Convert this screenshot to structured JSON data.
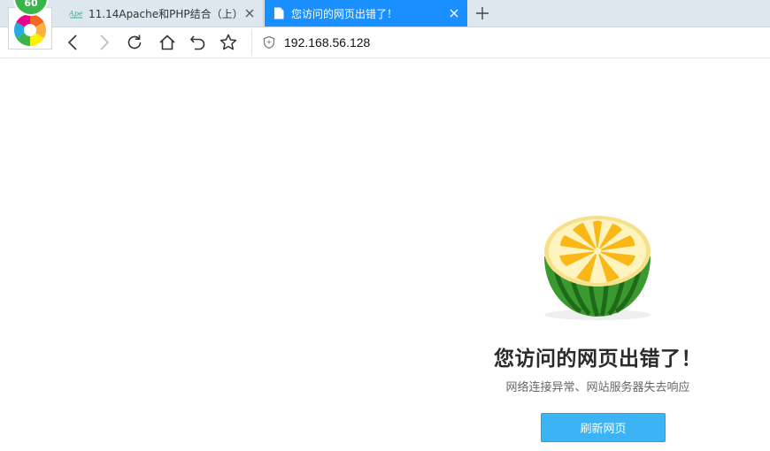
{
  "browser": {
    "badge_count": "60",
    "tabs": [
      {
        "label": "11.14Apache和PHP结合（上）",
        "favicon": "apeg-favicon-icon",
        "active": false
      },
      {
        "label": "您访问的网页出错了！",
        "favicon": "page-icon",
        "active": true
      }
    ],
    "address": {
      "url": "192.168.56.128"
    }
  },
  "error_page": {
    "title": "您访问的网页出错了！",
    "subtitle": "网络连接异常、网站服务器失去响应",
    "refresh_label": "刷新网页",
    "illustration": "lemon-watermelon-illustration"
  },
  "colors": {
    "active_tab": "#1a8fff",
    "refresh_button": "#3cb3f5",
    "badge": "#39b54a"
  }
}
